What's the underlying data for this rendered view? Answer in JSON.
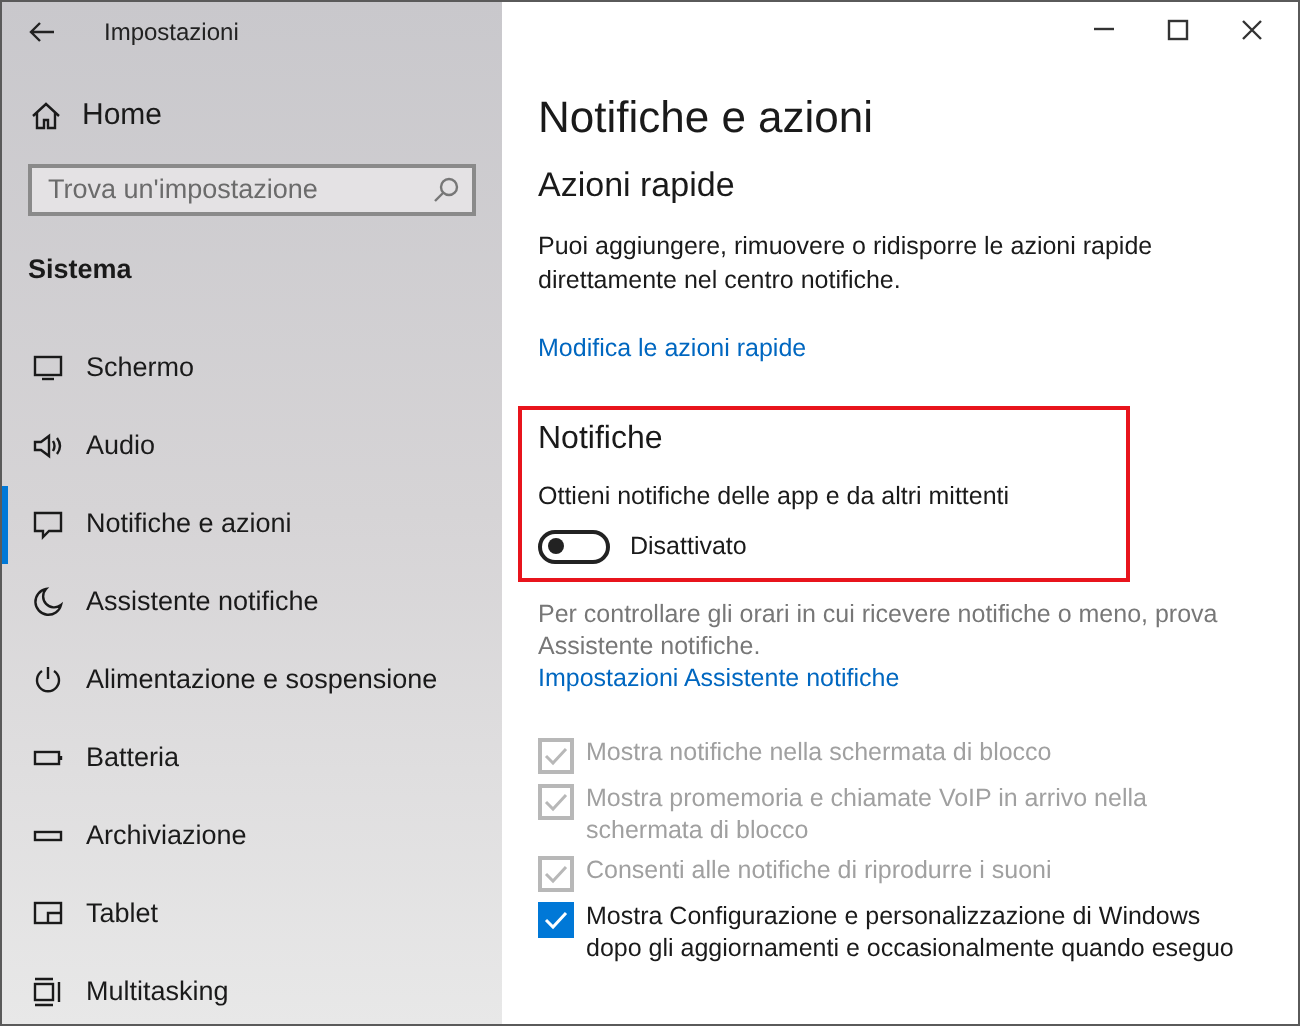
{
  "window": {
    "title": "Impostazioni"
  },
  "sidebar": {
    "home": "Home",
    "search": {
      "placeholder": "Trova un'impostazione"
    },
    "section": "Sistema",
    "items": [
      {
        "label": "Schermo",
        "selected": false
      },
      {
        "label": "Audio",
        "selected": false
      },
      {
        "label": "Notifiche e azioni",
        "selected": true
      },
      {
        "label": "Assistente notifiche",
        "selected": false
      },
      {
        "label": "Alimentazione e sospensione",
        "selected": false
      },
      {
        "label": "Batteria",
        "selected": false
      },
      {
        "label": "Archiviazione",
        "selected": false
      },
      {
        "label": "Tablet",
        "selected": false
      },
      {
        "label": "Multitasking",
        "selected": false
      }
    ]
  },
  "page": {
    "title": "Notifiche e azioni",
    "quick_actions": {
      "heading": "Azioni rapide",
      "description": "Puoi aggiungere, rimuovere o ridisporre le azioni rapide direttamente nel centro notifiche.",
      "link": "Modifica le azioni rapide"
    },
    "notifications": {
      "heading": "Notifiche",
      "setting": "Ottieni notifiche delle app e da altri mittenti",
      "toggle": {
        "on": false,
        "label": "Disattivato"
      }
    },
    "assistant": {
      "description": "Per controllare gli orari in cui ricevere notifiche o meno, prova Assistente notifiche.",
      "link": "Impostazioni Assistente notifiche"
    },
    "options": [
      {
        "label": "Mostra notifiche nella schermata di blocco",
        "checked": true,
        "disabled": true
      },
      {
        "label": "Mostra promemoria e chiamate VoIP in arrivo nella schermata di blocco",
        "checked": true,
        "disabled": true
      },
      {
        "label": "Consenti alle notifiche di riprodurre i suoni",
        "checked": true,
        "disabled": true
      },
      {
        "label": "Mostra Configurazione e personalizzazione di Windows dopo gli aggiornamenti e occasionalmente quando eseguo",
        "checked": true,
        "disabled": false
      }
    ]
  }
}
